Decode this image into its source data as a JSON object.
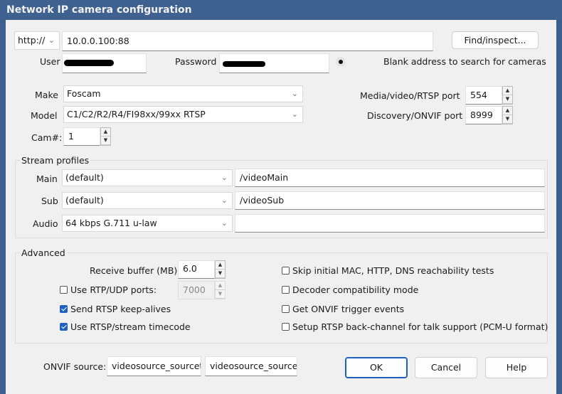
{
  "window": {
    "title": "Network IP camera configuration"
  },
  "address": {
    "scheme": "http://",
    "value": "10.0.0.100:88",
    "find_button": "Find/inspect...",
    "hint": "Blank address to search for cameras"
  },
  "credentials": {
    "user_label": "User",
    "password_label": "Password",
    "show_password_icon": "eye-icon"
  },
  "camera": {
    "make_label": "Make",
    "make": "Foscam",
    "model_label": "Model",
    "model": "C1/C2/R2/R4/FI98xx/99xx RTSP",
    "cam_label": "Cam#:",
    "cam": "1",
    "media_port_label": "Media/video/RTSP port",
    "media_port": "554",
    "onvif_port_label": "Discovery/ONVIF port",
    "onvif_port": "8999"
  },
  "streams": {
    "title": "Stream profiles",
    "main_label": "Main",
    "main_profile": "(default)",
    "main_path": "/videoMain",
    "sub_label": "Sub",
    "sub_profile": "(default)",
    "sub_path": "/videoSub",
    "audio_label": "Audio",
    "audio_profile": "64 kbps G.711 u-law",
    "audio_path": ""
  },
  "advanced": {
    "title": "Advanced",
    "buffer_label": "Receive buffer (MB)",
    "buffer": "6.0",
    "rtp_label": "Use RTP/UDP ports:",
    "rtp_checked": false,
    "rtp_port": "7000",
    "keepalive_label": "Send RTSP keep-alives",
    "keepalive_checked": true,
    "timecode_label": "Use RTSP/stream timecode",
    "timecode_checked": true,
    "skip_label": "Skip initial MAC, HTTP, DNS reachability tests",
    "decoder_label": "Decoder compatibility mode",
    "trigger_label": "Get ONVIF trigger events",
    "backchannel_label": "Setup RTSP back-channel for talk support (PCM-U format)"
  },
  "onvif": {
    "label": "ONVIF source:",
    "source1": "videosource_sourcet",
    "source2": "videosource_sourcet"
  },
  "buttons": {
    "ok": "OK",
    "cancel": "Cancel",
    "help": "Help"
  }
}
